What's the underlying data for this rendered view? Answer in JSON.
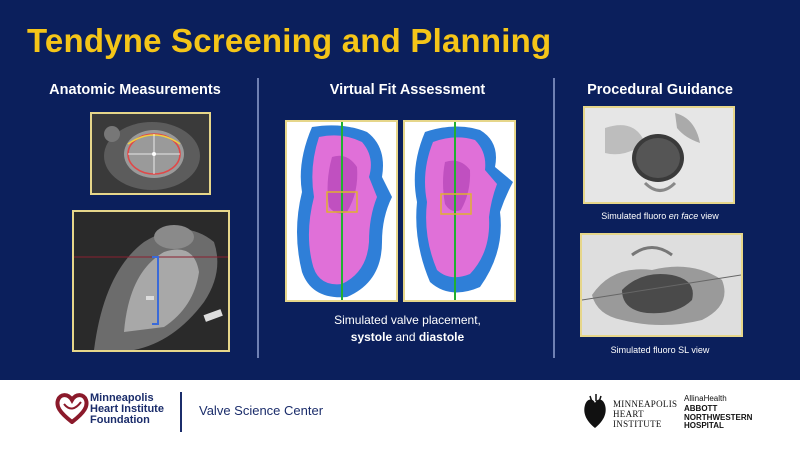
{
  "title": "Tendyne Screening and Planning",
  "columns": {
    "anatomic": {
      "heading": "Anatomic  Measurements"
    },
    "virtual": {
      "heading": "Virtual Fit Assessment",
      "caption_line1": "Simulated valve  placement,",
      "caption_bold1": "systole",
      "caption_and": " and ",
      "caption_bold2": "diastole"
    },
    "guidance": {
      "heading": "Procedural Guidance",
      "caption1_pre": "Simulated fluoro ",
      "caption1_em": "en face",
      "caption1_post": " view",
      "caption2": "Simulated fluoro SL view"
    }
  },
  "footer": {
    "mhif_line1": "Minneapolis",
    "mhif_line2": "Heart Institute",
    "mhif_line3": "Foundation",
    "valve_science": "Valve Science Center",
    "mhi_line1": "Minneapolis",
    "mhi_line2": "Heart",
    "mhi_line3": "Institute",
    "allina": "AllinaHealth",
    "abbott_line1": "ABBOTT",
    "abbott_line2": "NORTHWESTERN",
    "abbott_line3": "HOSPITAL"
  },
  "colors": {
    "background": "#0b1f5c",
    "title": "#f5c518",
    "panel_border": "#e6d68a",
    "model_blue": "#2f7fd8",
    "model_pink": "#e070d8"
  }
}
